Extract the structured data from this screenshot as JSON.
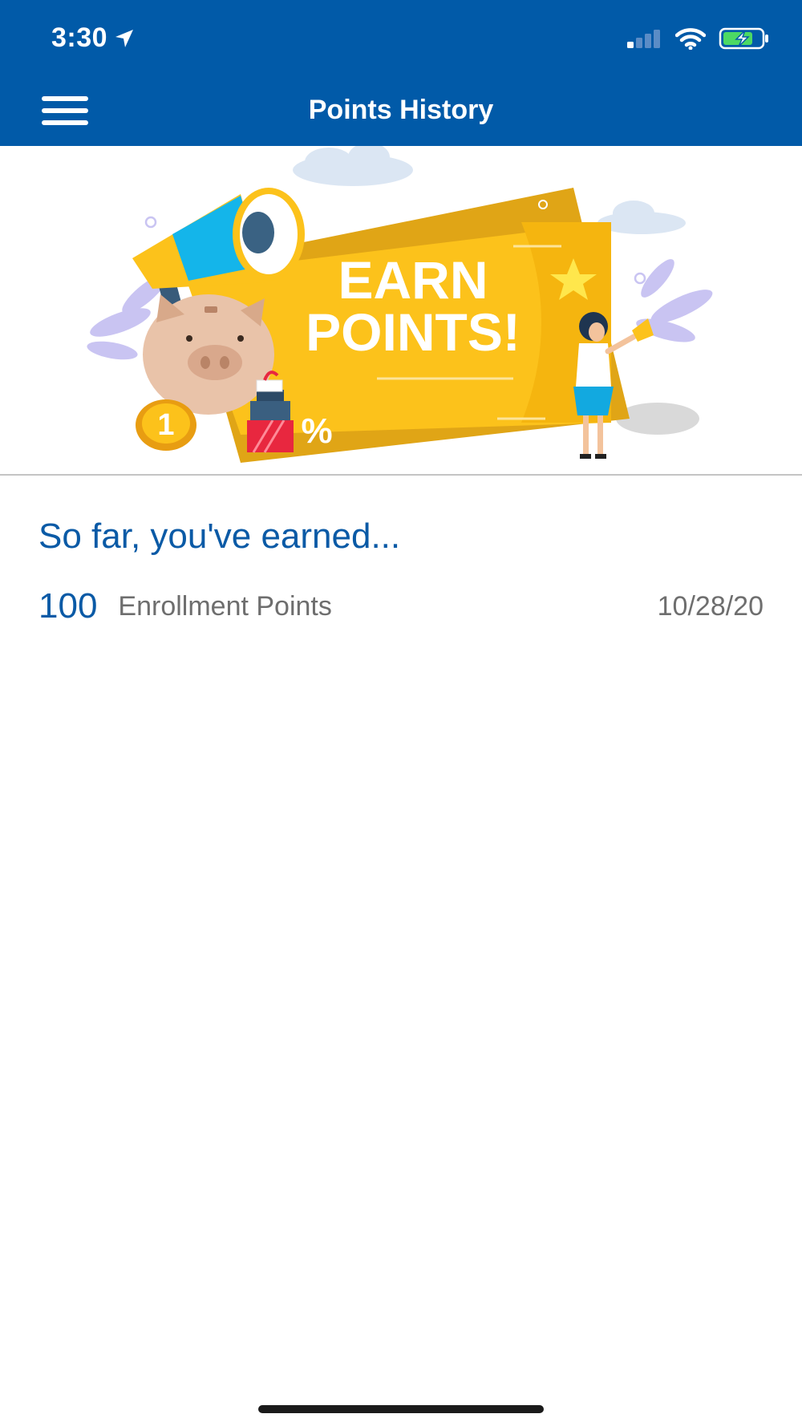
{
  "status_bar": {
    "time": "3:30",
    "icons": [
      "location-arrow-icon",
      "cellular-signal-icon",
      "wifi-icon",
      "battery-charging-icon"
    ]
  },
  "nav": {
    "title": "Points History",
    "menu_icon": "hamburger-menu-icon"
  },
  "banner": {
    "line1": "EARN",
    "line2": "POINTS!",
    "coin_number": "1",
    "percent_sign": "%"
  },
  "summary": {
    "heading": "So far, you've earned...",
    "entries": [
      {
        "points": "100",
        "label": "Enrollment Points",
        "date": "10/28/20"
      }
    ]
  },
  "colors": {
    "brand_blue": "#015aa8",
    "heading_blue": "#0a5aa6",
    "muted_text": "#6e6e6e",
    "ticket_yellow": "#fcc21b",
    "battery_green": "#4cd964"
  }
}
